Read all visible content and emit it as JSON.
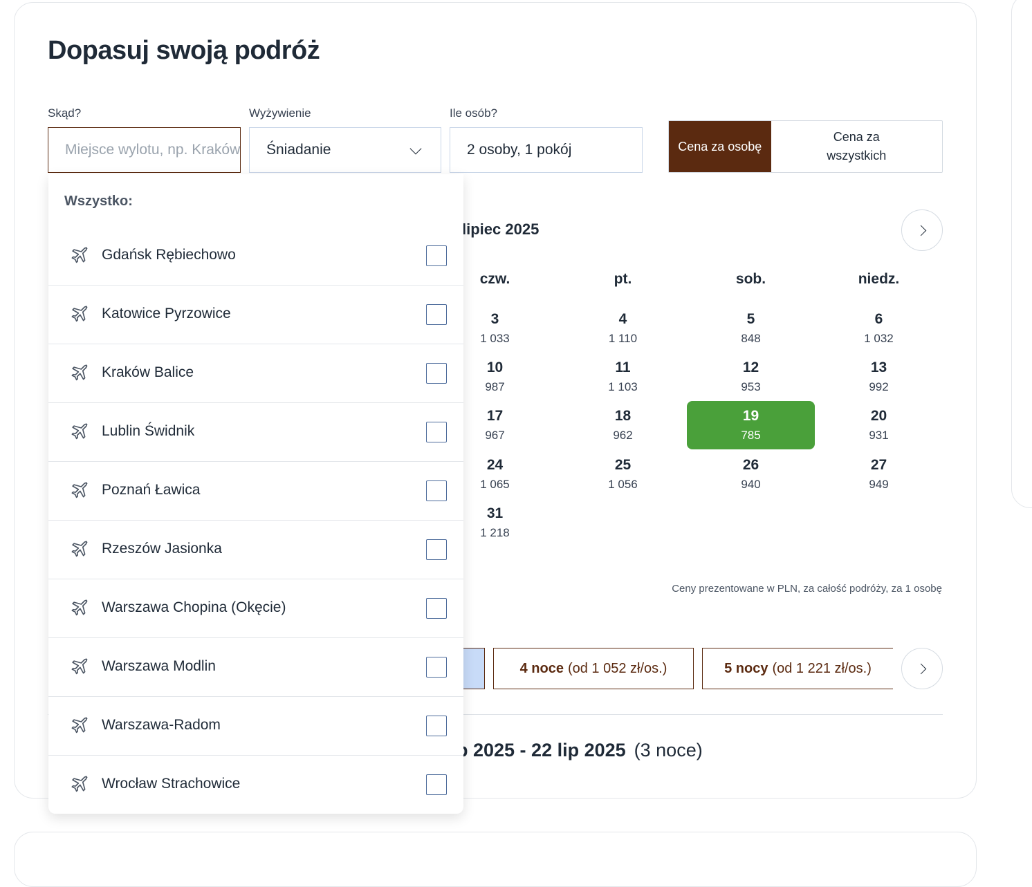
{
  "title": "Dopasuj swoją podróż",
  "fields": {
    "from_label": "Skąd?",
    "from_placeholder": "Miejsce wylotu, np. Kraków",
    "food_label": "Wyżywienie",
    "food_value": "Śniadanie",
    "people_label": "Ile osób?",
    "people_value": "2 osoby, 1 pokój"
  },
  "price_toggle": {
    "per_person": "Cena za osobę",
    "all": "Cena za wszystkich",
    "active": "per_person"
  },
  "calendar": {
    "month": "lipiec 2025",
    "weekdays": [
      "czw.",
      "pt.",
      "sob.",
      "niedz."
    ],
    "rows": [
      [
        {
          "d": "3",
          "p": "1 033"
        },
        {
          "d": "4",
          "p": "1 110"
        },
        {
          "d": "5",
          "p": "848"
        },
        {
          "d": "6",
          "p": "1 032"
        }
      ],
      [
        {
          "d": "10",
          "p": "987"
        },
        {
          "d": "11",
          "p": "1 103"
        },
        {
          "d": "12",
          "p": "953"
        },
        {
          "d": "13",
          "p": "992"
        }
      ],
      [
        {
          "d": "17",
          "p": "967"
        },
        {
          "d": "18",
          "p": "962"
        },
        {
          "d": "19",
          "p": "785",
          "selected": true
        },
        {
          "d": "20",
          "p": "931"
        }
      ],
      [
        {
          "d": "24",
          "p": "1 065"
        },
        {
          "d": "25",
          "p": "1 056"
        },
        {
          "d": "26",
          "p": "940"
        },
        {
          "d": "27",
          "p": "949"
        }
      ],
      [
        {
          "d": "31",
          "p": "1 218"
        }
      ]
    ],
    "note": "Ceny prezentowane w PLN, za całość podróży, za 1 osobę"
  },
  "nights": [
    {
      "bold": "4 noce",
      "rest": "(od 1 052 zł/os.)"
    },
    {
      "bold": "5 nocy",
      "rest": "(od 1 221 zł/os.)"
    }
  ],
  "range": {
    "dates": "p 2025 - 22 lip 2025",
    "nights": "(3 noce)"
  },
  "dropdown": {
    "heading": "Wszystko:",
    "airports": [
      "Gdańsk Rębiechowo",
      "Katowice Pyrzowice",
      "Kraków Balice",
      "Lublin Świdnik",
      "Poznań Ławica",
      "Rzeszów Jasionka",
      "Warszawa Chopina (Okęcie)",
      "Warszawa Modlin",
      "Warszawa-Radom",
      "Wrocław Strachowice"
    ]
  },
  "colors": {
    "brand": "#5b2a10",
    "selected_day": "#4aa03a",
    "night_highlight": "#c8dbf8"
  },
  "icons": {
    "airport": "airplane-icon",
    "next": "chevron-right-icon",
    "dropdown": "chevron-down-icon"
  }
}
